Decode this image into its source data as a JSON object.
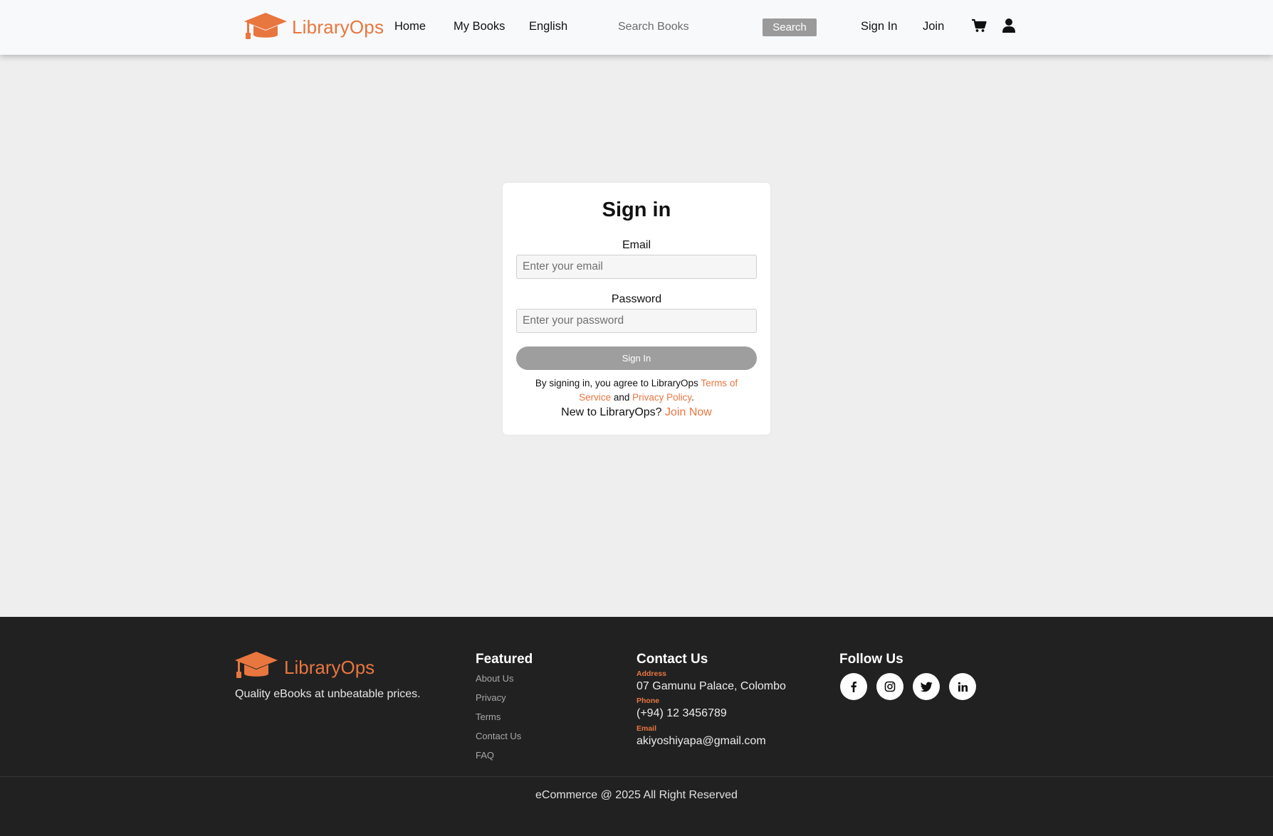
{
  "header": {
    "brand": "LibraryOps",
    "nav": {
      "home": "Home",
      "my_books": "My Books",
      "language": "English"
    },
    "search": {
      "placeholder": "Search Books",
      "button": "Search"
    },
    "sign_in": "Sign In",
    "join": "Join",
    "icons": [
      "cart-icon",
      "user-icon"
    ]
  },
  "signin_card": {
    "title": "Sign in",
    "email_label": "Email",
    "email_placeholder": "Enter your email",
    "password_label": "Password",
    "password_placeholder": "Enter your password",
    "submit": "Sign In",
    "terms_prefix": "By signing in, you agree to LibraryOps ",
    "terms_link": "Terms of Service",
    "terms_and": " and ",
    "privacy_link": "Privacy Policy",
    "terms_suffix": ".",
    "new_prefix": "New to LibraryOps? ",
    "join_link": "Join Now"
  },
  "footer": {
    "brand": "LibraryOps",
    "tagline": "Quality eBooks at unbeatable prices.",
    "featured": {
      "heading": "Featured",
      "links": [
        "About Us",
        "Privacy",
        "Terms",
        "Contact Us",
        "FAQ"
      ]
    },
    "contact": {
      "heading": "Contact Us",
      "address_label": "Address",
      "address": "07 Gamunu Palace, Colombo",
      "phone_label": "Phone",
      "phone": "(+94) 12 3456789",
      "email_label": "Email",
      "email": "akiyoshiyapa@gmail.com"
    },
    "follow": {
      "heading": "Follow Us",
      "icons": [
        "facebook-icon",
        "instagram-icon",
        "twitter-icon",
        "linkedin-icon"
      ]
    },
    "copyright": "eCommerce @ 2025 All Right Reserved"
  },
  "colors": {
    "accent": "#e8763f",
    "page_bg": "#eeeeee",
    "footer_bg": "#212121",
    "button_gray": "#9e9e9e"
  }
}
